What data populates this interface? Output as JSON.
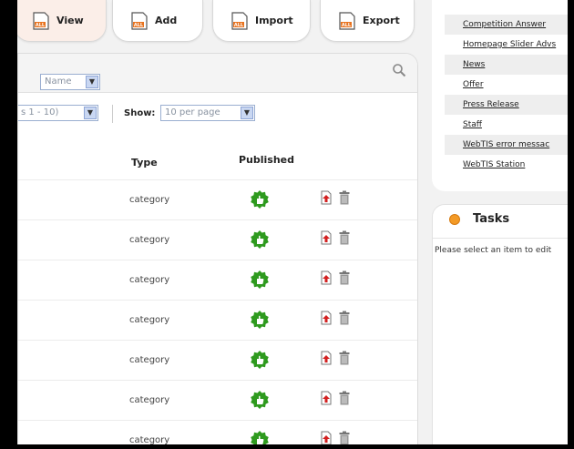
{
  "toolbar": {
    "buttons": [
      {
        "label": "View",
        "icon": "list-document-icon"
      },
      {
        "label": "Add",
        "icon": "list-document-icon"
      },
      {
        "label": "Import",
        "icon": "list-document-icon"
      },
      {
        "label": "Export",
        "icon": "list-document-icon"
      }
    ],
    "icon_badge": "ALL"
  },
  "filter": {
    "field_select": "Name"
  },
  "pager": {
    "range_select": "s 1 - 10)",
    "show_label": "Show:",
    "per_page_select": "10 per page"
  },
  "table": {
    "headers": {
      "type": "Type",
      "published": "Published"
    },
    "rows": [
      {
        "type": "category"
      },
      {
        "type": "category"
      },
      {
        "type": "category"
      },
      {
        "type": "category"
      },
      {
        "type": "category"
      },
      {
        "type": "category"
      },
      {
        "type": "category"
      }
    ]
  },
  "sidebar": {
    "links": [
      "Competition Answer",
      "Homepage Slider Advs",
      "News",
      "Offer",
      "Press Release",
      "Staff",
      "WebTIS error messac",
      "WebTIS Station"
    ]
  },
  "tasks": {
    "title": "Tasks",
    "message": "Please select an item to edit"
  },
  "colors": {
    "published_green": "#2e9a1e",
    "select_border": "#9aaed0",
    "tasks_orange": "#f39a26"
  }
}
